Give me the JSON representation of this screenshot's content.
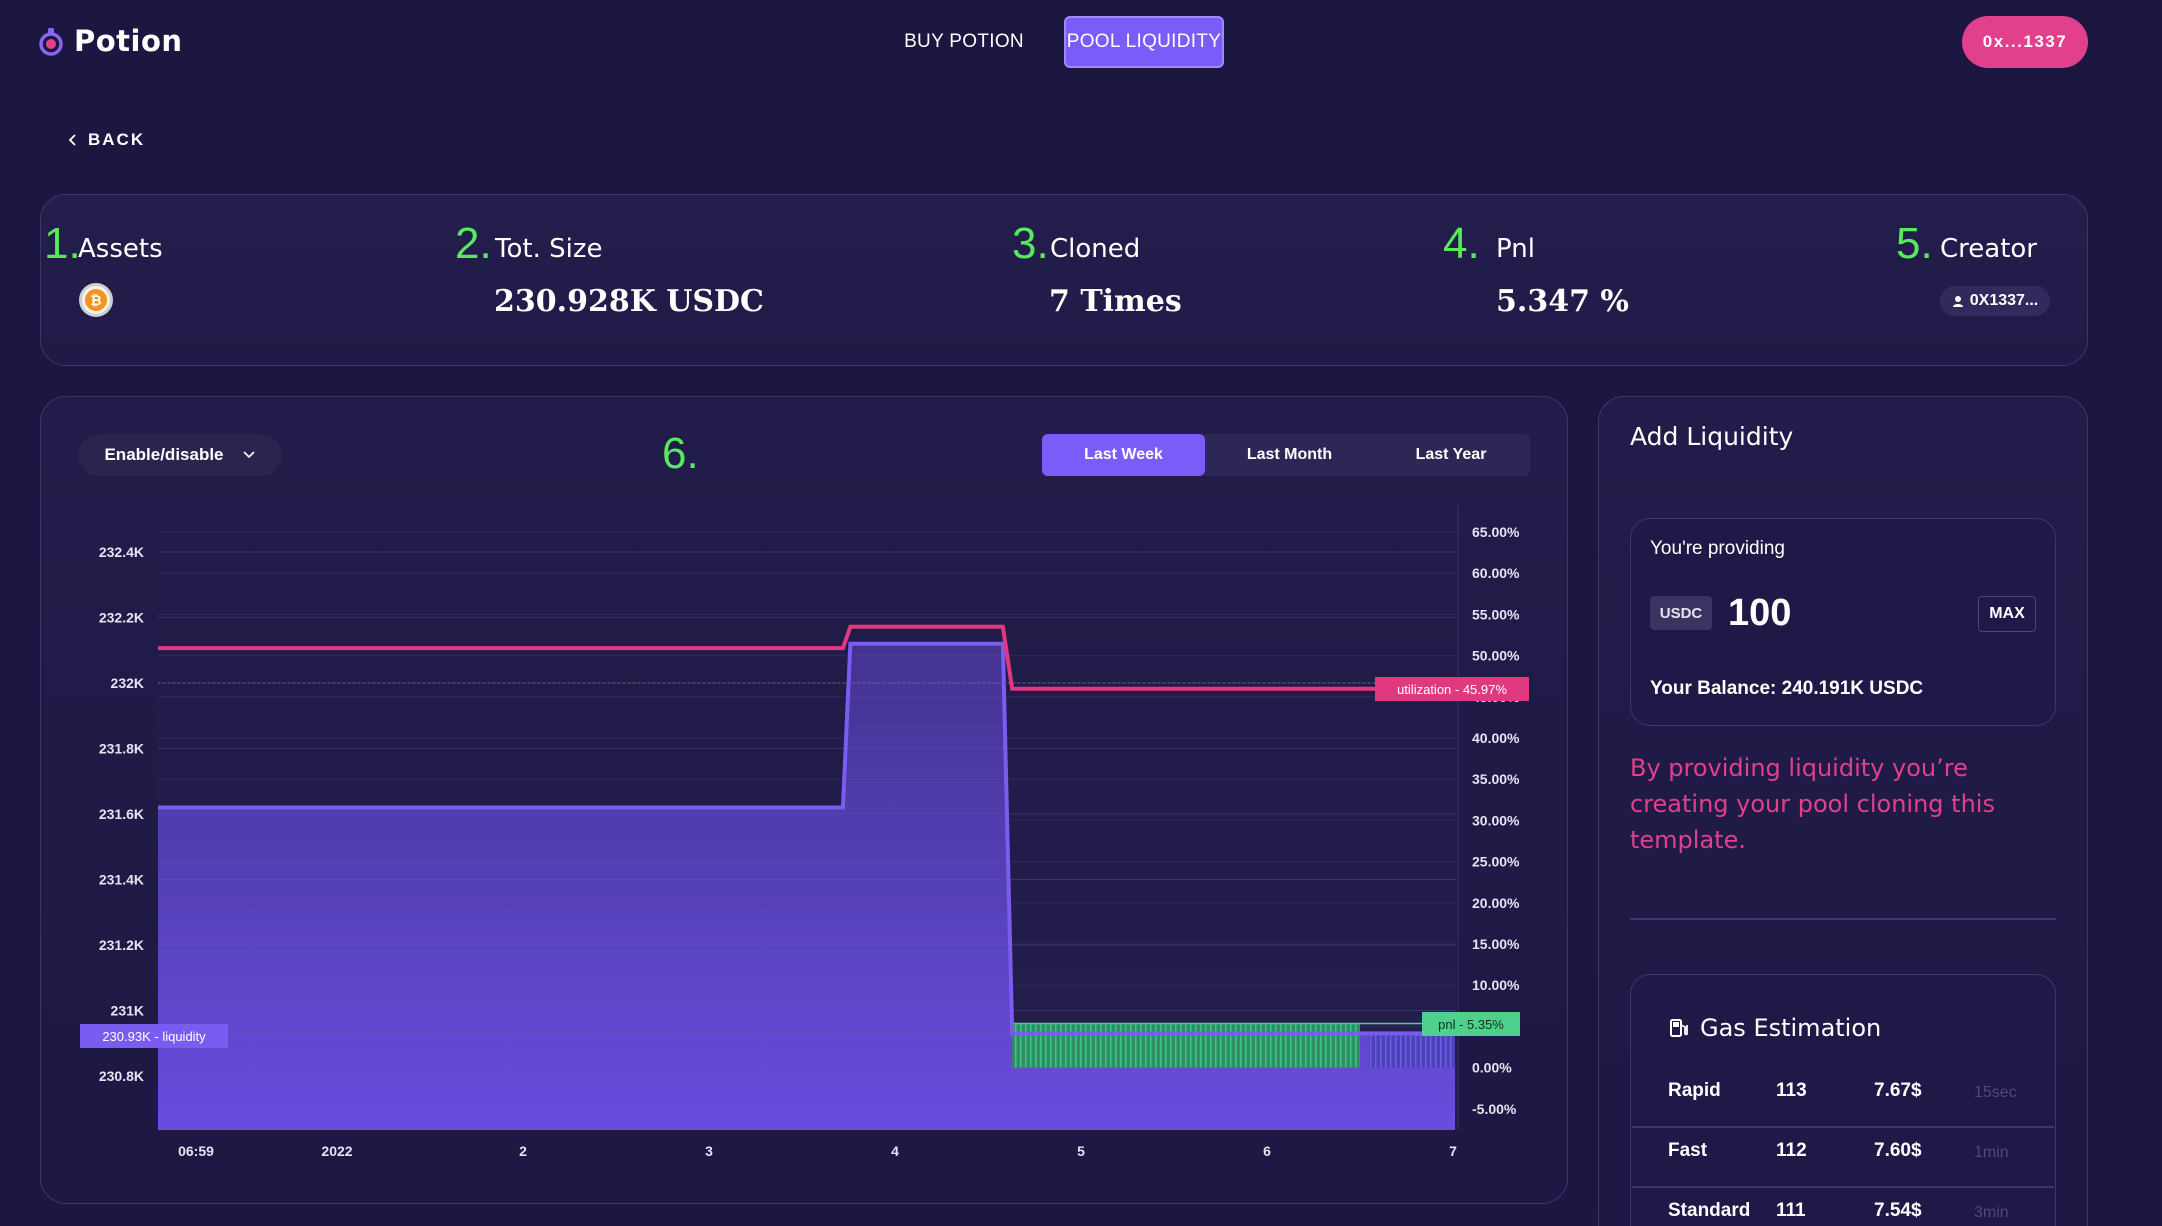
{
  "header": {
    "logo_text": "Potion",
    "nav": [
      {
        "label": "BUY POTION",
        "active": false
      },
      {
        "label": "POOL LIQUIDITY",
        "active": true
      }
    ],
    "wallet_label": "0x...1337"
  },
  "back_label": "BACK",
  "stats": [
    {
      "number": "1.",
      "label": "Assets",
      "value": ""
    },
    {
      "number": "2.",
      "label": "Tot. Size",
      "value": "230.928K USDC"
    },
    {
      "number": "3.",
      "label": "Cloned",
      "value": "7 Times"
    },
    {
      "number": "4.",
      "label": "Pnl",
      "value": "5.347 %"
    },
    {
      "number": "5.",
      "label": "Creator",
      "value": "0X1337..."
    }
  ],
  "asset_icon": "bitcoin-icon",
  "chart_panel": {
    "toggle_label": "Enable/disable",
    "number": "6.",
    "ranges": [
      {
        "label": "Last Week",
        "active": true
      },
      {
        "label": "Last Month",
        "active": false
      },
      {
        "label": "Last Year",
        "active": false
      }
    ]
  },
  "colors": {
    "background": "#1c1740",
    "accent": "#7c5cf8",
    "pink": "#e23f8d",
    "green": "#57ea5c",
    "liquidity_line": "#7b5cf0",
    "utilization_line": "#e0397f",
    "pnl": "#2fa36d"
  },
  "chart_data": {
    "type": "line",
    "x_tick_labels": [
      "06:59",
      "2022",
      "2",
      "3",
      "4",
      "5",
      "6",
      "7"
    ],
    "y_left": {
      "ticks": [
        "232.4K",
        "232.2K",
        "232K",
        "231.8K",
        "231.6K",
        "231.4K",
        "231.2K",
        "231K",
        "230.8K"
      ],
      "range": [
        230.7,
        232.5
      ],
      "unit": "K"
    },
    "y_right": {
      "ticks": [
        "65.00%",
        "60.00%",
        "55.00%",
        "50.00%",
        "45.00%",
        "40.00%",
        "35.00%",
        "30.00%",
        "25.00%",
        "20.00%",
        "15.00%",
        "10.00%",
        "5.00%",
        "0.00%",
        "-5.00%"
      ],
      "range": [
        -5,
        65
      ]
    },
    "series": [
      {
        "name": "liquidity",
        "axis": "left",
        "x": [
          0,
          3.72,
          3.76,
          4.58,
          4.63,
          6.5,
          6.55,
          6.98
        ],
        "y": [
          231.62,
          231.62,
          232.12,
          232.12,
          230.93,
          230.93,
          230.93,
          230.93
        ]
      },
      {
        "name": "utilization",
        "axis": "right",
        "x": [
          0,
          3.72,
          3.76,
          4.58,
          4.63,
          6.98
        ],
        "y": [
          50.9,
          50.9,
          53.5,
          53.5,
          45.97,
          45.97
        ]
      },
      {
        "name": "pnl",
        "axis": "right",
        "x": [
          4.63,
          6.5,
          6.55,
          6.98
        ],
        "y": [
          5.35,
          5.35,
          4.2,
          4.2
        ]
      }
    ],
    "labels": {
      "liquidity": "230.93K - liquidity",
      "utilization": "utilization - 45.97%",
      "pnl": "pnl - 5.35%"
    },
    "grid": true
  },
  "add_liquidity": {
    "title": "Add Liquidity",
    "providing_label": "You're providing",
    "token": "USDC",
    "amount": "100",
    "max_label": "MAX",
    "balance": "Your Balance: 240.191K USDC",
    "info": "By providing liquidity you’re creating your pool cloning this template.",
    "gas": {
      "title": "Gas Estimation",
      "rows": [
        {
          "speed": "Rapid",
          "gwei": "113",
          "cost": "7.67$",
          "time": "15sec"
        },
        {
          "speed": "Fast",
          "gwei": "112",
          "cost": "7.60$",
          "time": "1min"
        },
        {
          "speed": "Standard",
          "gwei": "111",
          "cost": "7.54$",
          "time": "3min"
        }
      ]
    }
  }
}
